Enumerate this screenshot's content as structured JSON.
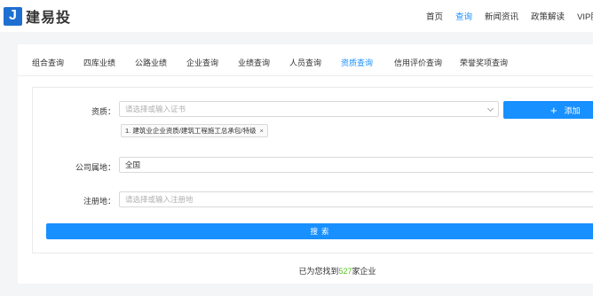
{
  "brand": {
    "logo_letter": "J",
    "name": "建易投"
  },
  "nav": {
    "items": [
      {
        "label": "首页",
        "active": false
      },
      {
        "label": "查询",
        "active": true
      },
      {
        "label": "新闻资讯",
        "active": false
      },
      {
        "label": "政策解读",
        "active": false
      },
      {
        "label": "VIP服务",
        "active": false
      }
    ]
  },
  "tabs": [
    {
      "label": "组合查询",
      "active": false
    },
    {
      "label": "四库业绩",
      "active": false
    },
    {
      "label": "公路业绩",
      "active": false
    },
    {
      "label": "企业查询",
      "active": false
    },
    {
      "label": "业绩查询",
      "active": false
    },
    {
      "label": "人员查询",
      "active": false
    },
    {
      "label": "资质查询",
      "active": true
    },
    {
      "label": "信用评价查询",
      "active": false
    },
    {
      "label": "荣誉奖项查询",
      "active": false
    }
  ],
  "form": {
    "qualification": {
      "label": "资质：",
      "placeholder": "请选择或输入证书",
      "value": ""
    },
    "add_button": {
      "icon": "plus-icon",
      "label": "添加"
    },
    "selected_tag": {
      "text": "1. 建筑业企业资质/建筑工程施工总承包/特级",
      "remove": "×"
    },
    "location": {
      "label": "公司属地：",
      "value": "全国"
    },
    "registration": {
      "label": "注册地：",
      "placeholder": "请选择或输入注册地",
      "value": ""
    },
    "search_button": "搜索"
  },
  "result": {
    "prefix": "已为您找到",
    "count": "527",
    "suffix": "家企业"
  },
  "colors": {
    "accent": "#1890ff",
    "count": "#52c41a",
    "logo": "#1f6fd1"
  }
}
